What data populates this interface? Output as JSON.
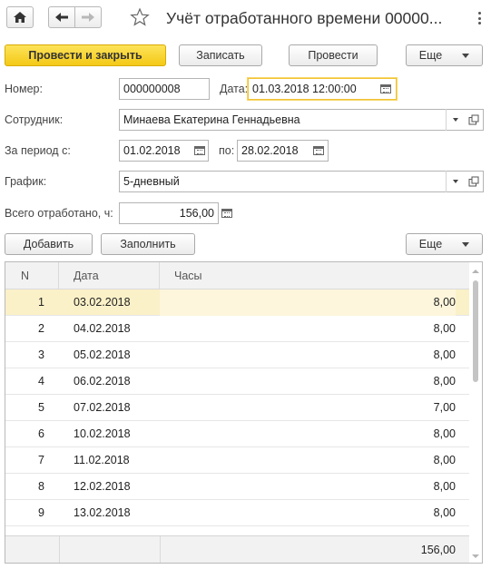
{
  "window": {
    "title": "Учёт отработанного времени 00000..."
  },
  "toolbar": {
    "post_close": "Провести и закрыть",
    "save": "Записать",
    "post": "Провести",
    "more": "Еще"
  },
  "form": {
    "number_label": "Номер:",
    "number_value": "000000008",
    "date_label": "Дата:",
    "date_value": "01.03.2018 12:00:00",
    "employee_label": "Сотрудник:",
    "employee_value": "Минаева Екатерина Геннадьевна",
    "period_label": "За период с:",
    "period_from": "01.02.2018",
    "period_to_label": "по:",
    "period_to": "28.02.2018",
    "schedule_label": "График:",
    "schedule_value": "5-дневный",
    "total_label": "Всего отработано, ч:",
    "total_value": "156,00"
  },
  "table_toolbar": {
    "add": "Добавить",
    "fill": "Заполнить",
    "more": "Еще"
  },
  "table": {
    "columns": [
      "N",
      "Дата",
      "Часы"
    ],
    "rows": [
      {
        "n": "1",
        "date": "03.02.2018",
        "hours": "8,00"
      },
      {
        "n": "2",
        "date": "04.02.2018",
        "hours": "8,00"
      },
      {
        "n": "3",
        "date": "05.02.2018",
        "hours": "8,00"
      },
      {
        "n": "4",
        "date": "06.02.2018",
        "hours": "8,00"
      },
      {
        "n": "5",
        "date": "07.02.2018",
        "hours": "7,00"
      },
      {
        "n": "6",
        "date": "10.02.2018",
        "hours": "8,00"
      },
      {
        "n": "7",
        "date": "11.02.2018",
        "hours": "8,00"
      },
      {
        "n": "8",
        "date": "12.02.2018",
        "hours": "8,00"
      },
      {
        "n": "9",
        "date": "13.02.2018",
        "hours": "8,00"
      }
    ],
    "footer_total": "156,00"
  },
  "colors": {
    "primary_button": "#f4c915",
    "selected_row": "#fbf1c8",
    "focus_border": "#f1c232"
  }
}
